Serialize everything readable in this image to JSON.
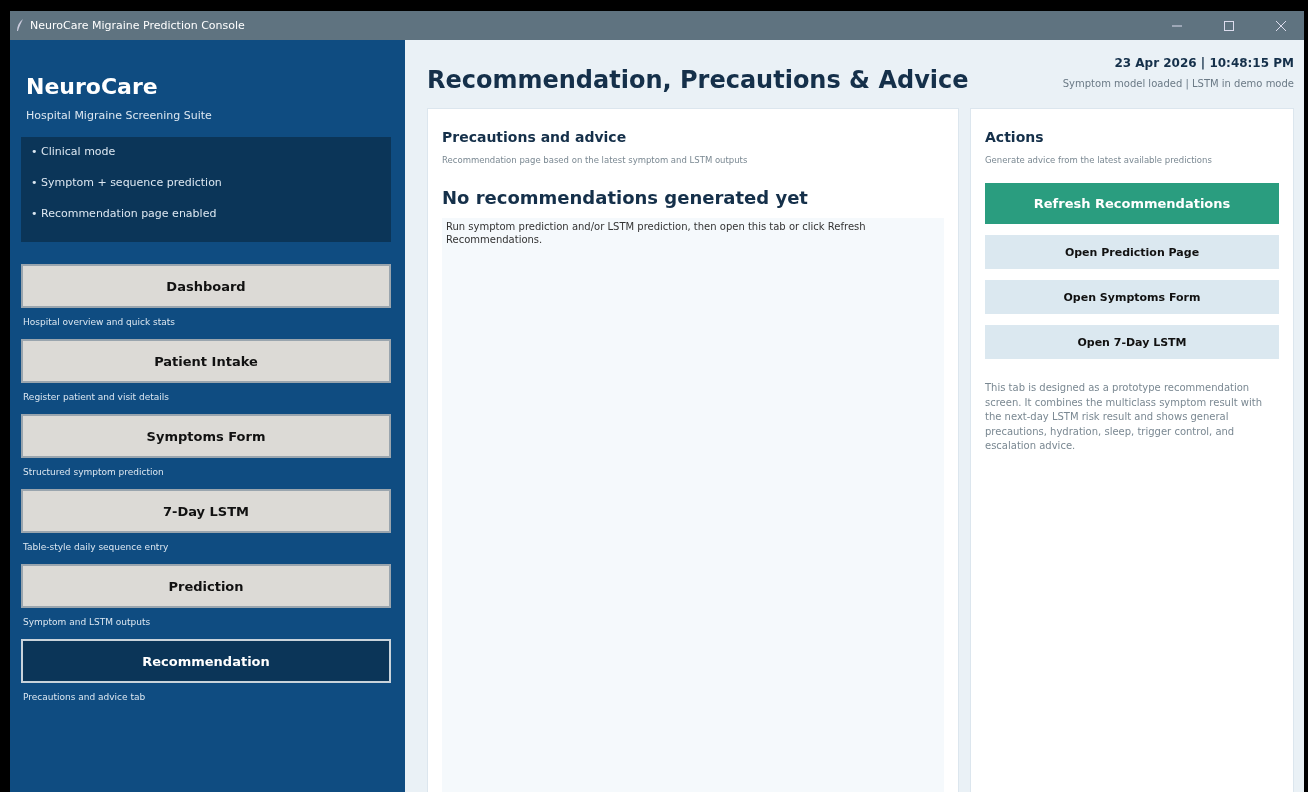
{
  "window": {
    "title": "NeuroCare Migraine Prediction Console"
  },
  "sidebar": {
    "brand": "NeuroCare",
    "subtitle": "Hospital Migraine Screening Suite",
    "features": [
      "• Clinical mode",
      "• Symptom + sequence prediction",
      "• Recommendation page enabled"
    ],
    "nav": [
      {
        "label": "Dashboard",
        "caption": "Hospital overview and quick stats",
        "selected": false
      },
      {
        "label": "Patient Intake",
        "caption": "Register patient and visit details",
        "selected": false
      },
      {
        "label": "Symptoms Form",
        "caption": "Structured symptom prediction",
        "selected": false
      },
      {
        "label": "7-Day LSTM",
        "caption": "Table-style daily sequence entry",
        "selected": false
      },
      {
        "label": "Prediction",
        "caption": "Symptom and LSTM outputs",
        "selected": false
      },
      {
        "label": "Recommendation",
        "caption": "Precautions and advice tab",
        "selected": true
      }
    ]
  },
  "header": {
    "title": "Recommendation, Precautions & Advice",
    "datetime": "23 Apr 2026 | 10:48:15 PM",
    "status": "Symptom model loaded | LSTM in demo mode"
  },
  "advice_panel": {
    "title": "Precautions and advice",
    "subtitle": "Recommendation page based on the latest symptom and LSTM outputs",
    "heading": "No recommendations generated yet",
    "body": "Run symptom prediction and/or LSTM prediction, then open this tab or click Refresh Recommendations."
  },
  "actions_panel": {
    "title": "Actions",
    "subtitle": "Generate advice from the latest available predictions",
    "buttons": [
      {
        "label": "Refresh Recommendations",
        "kind": "primary"
      },
      {
        "label": "Open Prediction Page",
        "kind": "secondary"
      },
      {
        "label": "Open Symptoms Form",
        "kind": "secondary"
      },
      {
        "label": "Open 7-Day LSTM",
        "kind": "secondary"
      }
    ],
    "note": "This tab is designed as a prototype recommendation screen. It combines the multiclass symptom result with the next-day LSTM risk result and shows general precautions, hydration, sleep, trigger control, and escalation advice."
  }
}
